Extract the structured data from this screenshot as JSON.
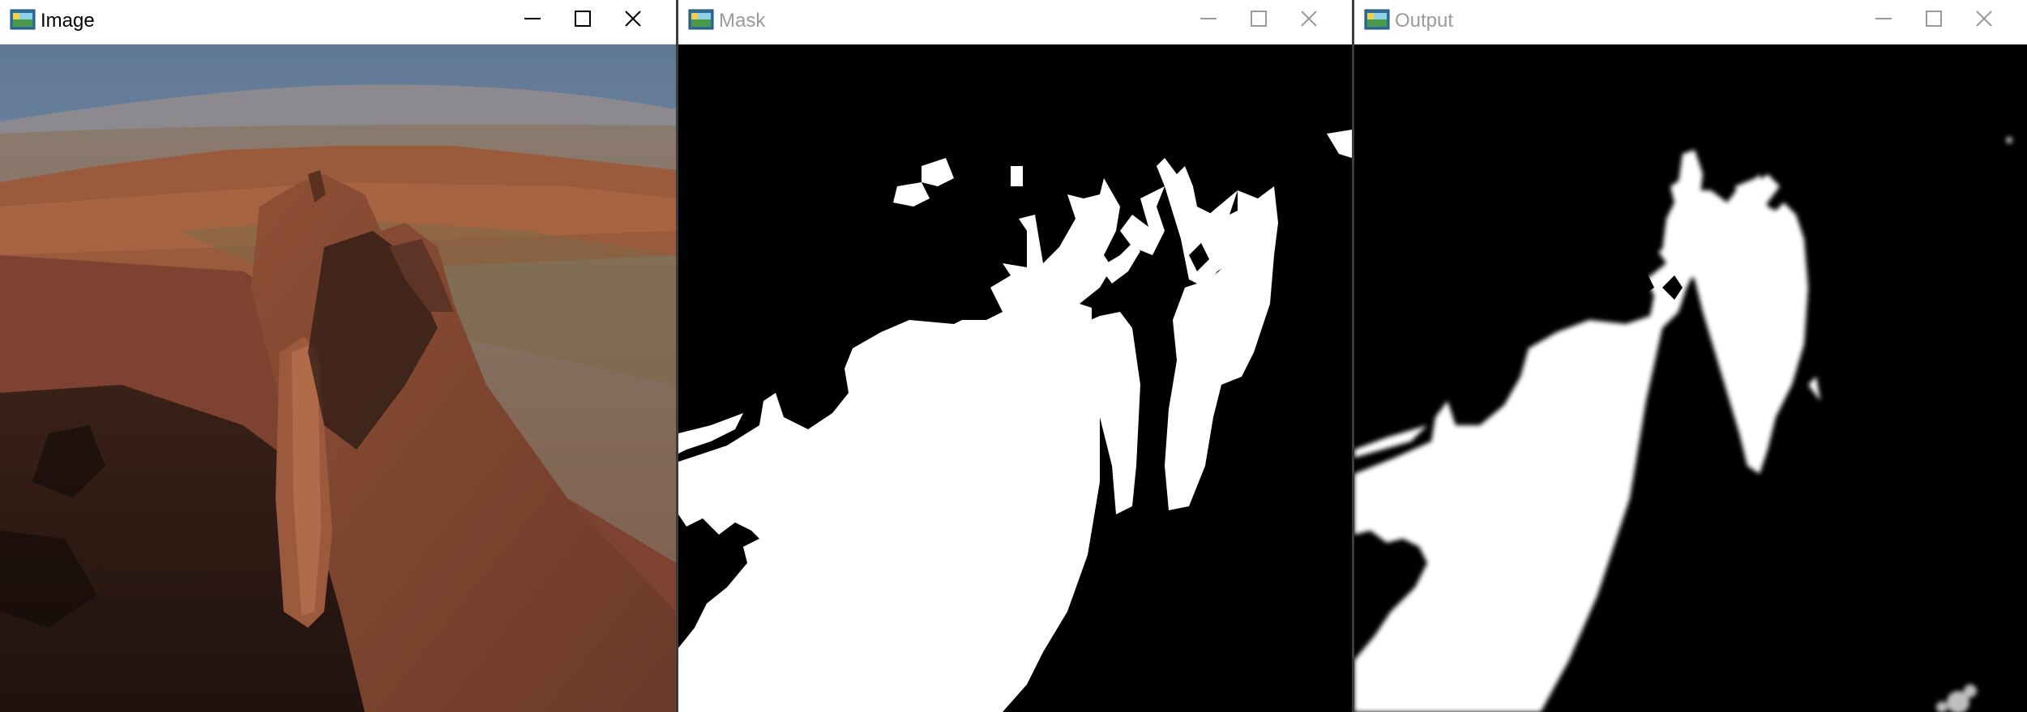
{
  "windows": [
    {
      "title": "Image",
      "active": true,
      "content": "canyon-photo"
    },
    {
      "title": "Mask",
      "active": false,
      "content": "binary-mask"
    },
    {
      "title": "Output",
      "active": false,
      "content": "refined-matte"
    }
  ],
  "colors": {
    "titlebar": "#ffffff",
    "active_glyph": "#000000",
    "inactive_glyph": "#9a9a9a",
    "separator": "#3c3c3c",
    "mask_bg": "#000000",
    "mask_fg": "#ffffff"
  },
  "icons": {
    "app": "opencv-window-icon",
    "minimize": "minimize-icon",
    "maximize": "maximize-icon",
    "close": "close-icon"
  }
}
